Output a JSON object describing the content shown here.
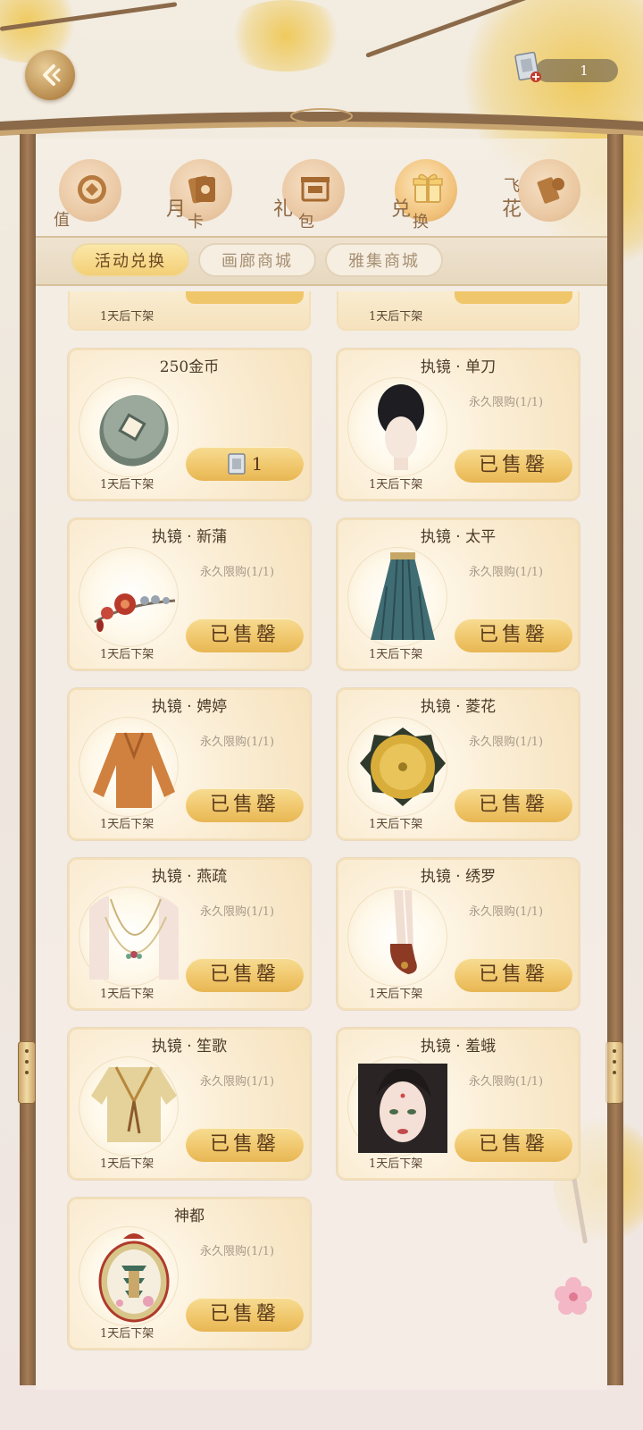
{
  "header": {
    "currency_value": "1"
  },
  "categories": [
    {
      "label_a": "",
      "label_b": "值",
      "icon": "coin-icon",
      "active": false
    },
    {
      "label_a": "月",
      "label_b": "卡",
      "icon": "card-icon",
      "active": false
    },
    {
      "label_a": "礼",
      "label_b": "包",
      "icon": "gift-box-icon",
      "active": false
    },
    {
      "label_a": "兑",
      "label_b": "换",
      "icon": "exchange-gift-icon",
      "active": true
    },
    {
      "label_a": "飞",
      "label_b": "花",
      "icon": "scroll-icon",
      "active": false
    }
  ],
  "subtabs": [
    {
      "label": "活动兑换",
      "active": true
    },
    {
      "label": "画廊商城",
      "active": false
    },
    {
      "label": "雅集商城",
      "active": false
    }
  ],
  "partial_row": [
    {
      "expire": "1天后下架"
    },
    {
      "expire": "1天后下架"
    }
  ],
  "items": [
    {
      "title": "250金币",
      "limit": "",
      "button": "1",
      "expire": "1天后下架",
      "icon": "ancient-coin-icon",
      "sold": false
    },
    {
      "title": "执镜 · 单刀",
      "limit": "永久限购(1/1)",
      "button": "已售罄",
      "expire": "1天后下架",
      "icon": "hairstyle-icon",
      "sold": true
    },
    {
      "title": "执镜 · 新蒲",
      "limit": "永久限购(1/1)",
      "button": "已售罄",
      "expire": "1天后下架",
      "icon": "flower-hairpin-icon",
      "sold": true
    },
    {
      "title": "执镜 · 太平",
      "limit": "永久限购(1/1)",
      "button": "已售罄",
      "expire": "1天后下架",
      "icon": "skirt-icon",
      "sold": true
    },
    {
      "title": "执镜 · 娉婷",
      "limit": "永久限购(1/1)",
      "button": "已售罄",
      "expire": "1天后下架",
      "icon": "blouse-icon",
      "sold": true
    },
    {
      "title": "执镜 · 菱花",
      "limit": "永久限购(1/1)",
      "button": "已售罄",
      "expire": "1天后下架",
      "icon": "bronze-mirror-icon",
      "sold": true
    },
    {
      "title": "执镜 · 燕疏",
      "limit": "永久限购(1/1)",
      "button": "已售罄",
      "expire": "1天后下架",
      "icon": "necklace-icon",
      "sold": true
    },
    {
      "title": "执镜 · 绣罗",
      "limit": "永久限购(1/1)",
      "button": "已售罄",
      "expire": "1天后下架",
      "icon": "shoes-icon",
      "sold": true
    },
    {
      "title": "执镜 · 笙歌",
      "limit": "永久限购(1/1)",
      "button": "已售罄",
      "expire": "1天后下架",
      "icon": "top-garment-icon",
      "sold": true
    },
    {
      "title": "执镜 · 羞蛾",
      "limit": "永久限购(1/1)",
      "button": "已售罄",
      "expire": "1天后下架",
      "icon": "face-makeup-icon",
      "sold": true
    },
    {
      "title": "神都",
      "limit": "永久限购(1/1)",
      "button": "已售罄",
      "expire": "1天后下架",
      "icon": "pagoda-frame-icon",
      "sold": true
    }
  ],
  "colors": {
    "accent": "#f0c66a",
    "frame": "#8b6a4a",
    "text": "#4b3a28"
  }
}
